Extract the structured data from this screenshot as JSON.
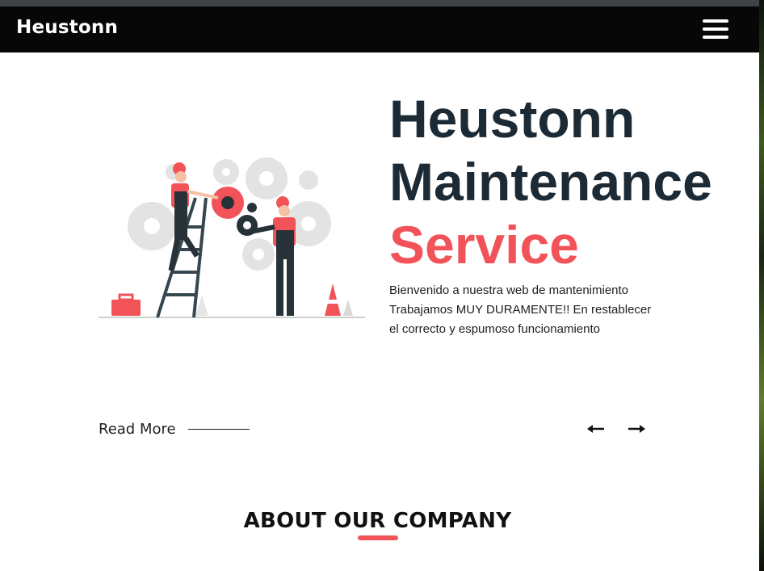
{
  "navbar": {
    "brand": "Heustonn",
    "menu_icon": "hamburger-menu-icon"
  },
  "hero": {
    "title_line1": "Heustonn",
    "title_line2": "Maintenance",
    "title_accent": "Service",
    "description": "Bienvenido a nuestra web de mantenimiento Trabajamos MUY DURAMENTE!! En restablecer el correcto y espumoso funcionamiento",
    "read_more_label": "Read More",
    "illustration": "maintenance-workers-illustration",
    "prev_icon": "arrow-left-icon",
    "next_icon": "arrow-right-icon"
  },
  "about": {
    "title": "ABOUT OUR COMPANY"
  },
  "colors": {
    "navbar_bg": "#070707",
    "title_dark": "#1b2a35",
    "accent": "#f25359",
    "text": "#1e1e1e"
  }
}
